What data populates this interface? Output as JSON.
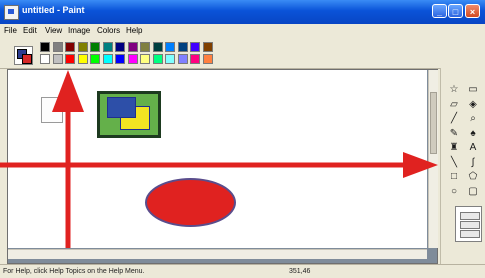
{
  "window": {
    "title": "untitled - Paint",
    "controls": {
      "minimize": "_",
      "maximize": "□",
      "close": "×"
    }
  },
  "menu": {
    "items": [
      "File",
      "Edit",
      "View",
      "Image",
      "Colors",
      "Help"
    ]
  },
  "palette": {
    "foreground_color": "#2b3b8f",
    "background_color": "#d62828",
    "colors_top": [
      "#000000",
      "#808080",
      "#800000",
      "#808000",
      "#008000",
      "#008080",
      "#000080",
      "#800080",
      "#808040",
      "#004040",
      "#0080ff",
      "#004080",
      "#4000ff",
      "#804000"
    ],
    "colors_bottom": [
      "#ffffff",
      "#c0c0c0",
      "#ff0000",
      "#ffff00",
      "#00ff00",
      "#00ffff",
      "#0000ff",
      "#ff00ff",
      "#ffff80",
      "#00ff80",
      "#80ffff",
      "#8080ff",
      "#ff0080",
      "#ff8040"
    ]
  },
  "canvas": {
    "shapes": [
      {
        "name": "blue-square",
        "color": "#2d4fa8"
      },
      {
        "name": "yellow-square",
        "color": "#f3e422"
      },
      {
        "name": "green-square",
        "color": "#64b04a"
      },
      {
        "name": "red-ellipse",
        "color": "#e02220"
      }
    ],
    "annotation_color": "#e02220"
  },
  "tools": [
    {
      "icon": "free-form-select-icon",
      "glyph": "☆"
    },
    {
      "icon": "select-icon",
      "glyph": "▭"
    },
    {
      "icon": "eraser-icon",
      "glyph": "▱"
    },
    {
      "icon": "fill-icon",
      "glyph": "◈"
    },
    {
      "icon": "pick-color-icon",
      "glyph": "╱"
    },
    {
      "icon": "magnifier-icon",
      "glyph": "⌕"
    },
    {
      "icon": "pencil-icon",
      "glyph": "✎"
    },
    {
      "icon": "brush-icon",
      "glyph": "♠"
    },
    {
      "icon": "airbrush-icon",
      "glyph": "♜"
    },
    {
      "icon": "text-icon",
      "glyph": "A"
    },
    {
      "icon": "line-icon",
      "glyph": "╲"
    },
    {
      "icon": "curve-icon",
      "glyph": "∫"
    },
    {
      "icon": "rectangle-icon",
      "glyph": "□"
    },
    {
      "icon": "polygon-icon",
      "glyph": "⬠"
    },
    {
      "icon": "ellipse-icon",
      "glyph": "○"
    },
    {
      "icon": "rounded-rectangle-icon",
      "glyph": "▢"
    }
  ],
  "status": {
    "help_text": "For Help, click Help Topics on the Help Menu.",
    "coordinates": "351,46"
  }
}
